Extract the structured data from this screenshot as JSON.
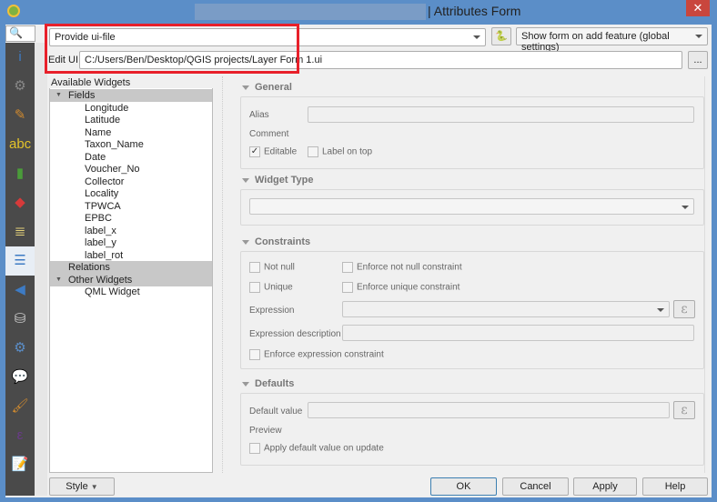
{
  "window": {
    "title": "| Attributes Form",
    "close": "✕"
  },
  "search": {
    "icon": "search-icon",
    "glyph": "🔍"
  },
  "sidebar": {
    "items": [
      {
        "name": "information-icon",
        "glyph": "i",
        "color": "#3d7bc4"
      },
      {
        "name": "source-settings-icon",
        "glyph": "⚙",
        "color": "#888"
      },
      {
        "name": "symbology-icon",
        "glyph": "✎",
        "color": "#d08a2f"
      },
      {
        "name": "labels-icon",
        "glyph": "abc",
        "color": "#e3c32a"
      },
      {
        "name": "diagrams-icon",
        "glyph": "▮",
        "color": "#4a9c3a"
      },
      {
        "name": "3d-view-icon",
        "glyph": "◆",
        "color": "#d63a3a"
      },
      {
        "name": "fields-icon",
        "glyph": "≣",
        "color": "#e6d37a"
      },
      {
        "name": "attributes-form-icon",
        "glyph": "☰",
        "color": "#3d7bc4"
      },
      {
        "name": "joins-icon",
        "glyph": "◀",
        "color": "#3d7bc4"
      },
      {
        "name": "auxiliary-storage-icon",
        "glyph": "⛁",
        "color": "#ccc"
      },
      {
        "name": "actions-icon",
        "glyph": "⚙",
        "color": "#5b8ec8"
      },
      {
        "name": "display-icon",
        "glyph": "💬",
        "color": "#e8e08a"
      },
      {
        "name": "rendering-icon",
        "glyph": "🖌",
        "color": "#d08a2f"
      },
      {
        "name": "variables-icon",
        "glyph": "ε",
        "color": "#6a3a8a"
      },
      {
        "name": "metadata-icon",
        "glyph": "📝",
        "color": "#eee"
      }
    ]
  },
  "top": {
    "editor_mode": "Provide ui-file",
    "python_icon": "python-icon",
    "form_suppress": "Show form on add feature (global settings)",
    "edit_ui_label": "Edit UI",
    "edit_ui_path": "C:/Users/Ben/Desktop/QGIS projects/Layer Form 1.ui",
    "browse": "..."
  },
  "tree": {
    "header": "Available Widgets",
    "fields_label": "Fields",
    "fields": [
      "Longitude",
      "Latitude",
      "Name",
      "Taxon_Name",
      "Date",
      "Voucher_No",
      "Collector",
      "Locality",
      "TPWCA",
      "EPBC",
      "label_x",
      "label_y",
      "label_rot"
    ],
    "relations_label": "Relations",
    "other_label": "Other Widgets",
    "other": [
      "QML Widget"
    ]
  },
  "general": {
    "title": "General",
    "alias_label": "Alias",
    "comment_label": "Comment",
    "editable_label": "Editable",
    "editable_checked": true,
    "label_on_top": "Label on top"
  },
  "widget_type": {
    "title": "Widget Type"
  },
  "constraints": {
    "title": "Constraints",
    "not_null": "Not null",
    "enforce_not_null": "Enforce not null constraint",
    "unique": "Unique",
    "enforce_unique": "Enforce unique constraint",
    "expression_label": "Expression",
    "expression_desc_label": "Expression description",
    "enforce_expression": "Enforce expression constraint",
    "epsilon": "ε"
  },
  "defaults": {
    "title": "Defaults",
    "default_value_label": "Default value",
    "preview_label": "Preview",
    "apply_on_update": "Apply default value on update",
    "epsilon": "ε"
  },
  "bottom": {
    "style": "Style",
    "ok": "OK",
    "cancel": "Cancel",
    "apply": "Apply",
    "help": "Help"
  }
}
